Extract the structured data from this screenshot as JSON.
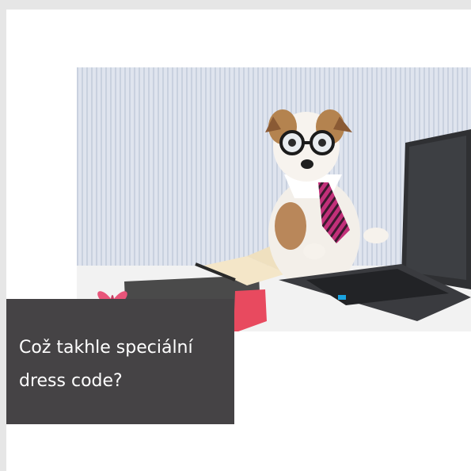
{
  "caption": {
    "line1": "Což takhle speciální",
    "line2": "dress code?"
  },
  "colors": {
    "page_background": "#e6e6e6",
    "card_background": "#ffffff",
    "caption_background": "#454345",
    "caption_text": "#ffffff",
    "accent_pink": "#e8557a"
  },
  "icons": {
    "logo": "butterfly-icon"
  }
}
